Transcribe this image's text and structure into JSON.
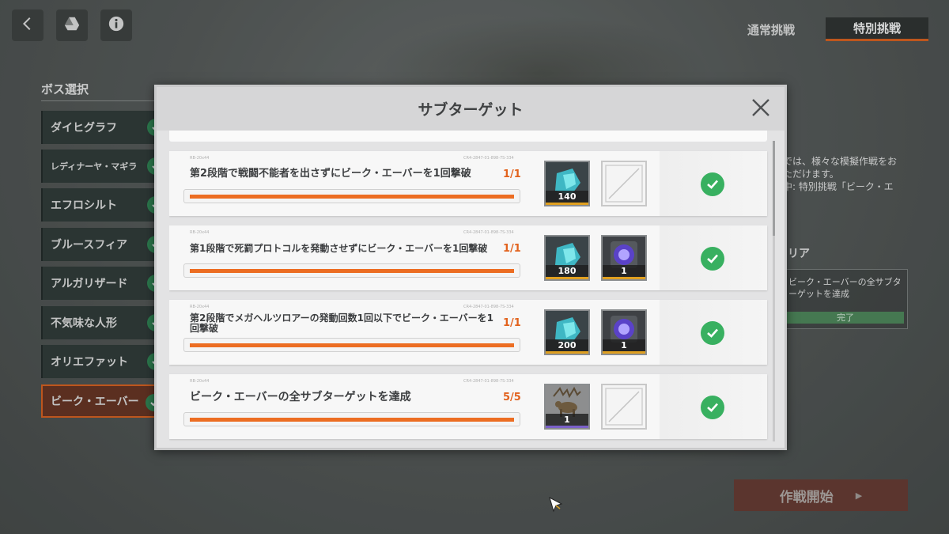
{
  "header": {
    "back_icon": "chevron-left-icon",
    "drive_icon": "triangle-logo-icon",
    "info_icon": "info-icon",
    "tabs": [
      {
        "label": "通常挑戦",
        "active": false
      },
      {
        "label": "特別挑戦",
        "active": true
      }
    ]
  },
  "boss_select": {
    "title": "ボス選択",
    "items": [
      {
        "label": "ダイヒグラフ",
        "cleared": true
      },
      {
        "label": "レディナーヤ・マギラ",
        "cleared": true
      },
      {
        "label": "エフロシルト",
        "cleared": true
      },
      {
        "label": "ブルースフィア",
        "cleared": true
      },
      {
        "label": "アルガリザード",
        "cleared": true
      },
      {
        "label": "不気味な人形",
        "cleared": true
      },
      {
        "label": "オリエファット",
        "cleared": true
      },
      {
        "label": "ビーク・エーバー",
        "cleared": true,
        "selected": true
      }
    ]
  },
  "right_panel": {
    "desc_line1": "では、様々な模擬作戦をお",
    "desc_line2": "ただけます。",
    "desc_line3": "中: 特別挑戦「ビーク・エ",
    "section_title": "リア",
    "box_text_1": "ビーク・エーバーの全サブタ",
    "box_text_2": "ーゲットを達成",
    "box_status": "完了"
  },
  "start_button": {
    "label": "作戦開始",
    "arrow": "▶"
  },
  "modal": {
    "title": "サブターゲット",
    "close_icon": "close-icon",
    "tasks": [
      {
        "code": "RB-20x44",
        "code2": "CR4-2847-01-898-7S-334",
        "label": "第2段階で戦闘不能者を出さずにビーク・エーバーを1回撃破",
        "progress": "1/1",
        "progress_fraction": 1.0,
        "rewards": [
          {
            "icon": "cyan-crystal-icon",
            "qty": "140",
            "rarity_color": "#e0a020"
          },
          {
            "icon": "empty-slot-icon",
            "qty": null
          }
        ],
        "claimed": true
      },
      {
        "code": "RB-20x44",
        "code2": "CR4-2847-01-898-7S-334",
        "label": "第1段階で死罰プロトコルを発動させずにビーク・エーバーを1回撃破",
        "progress": "1/1",
        "progress_fraction": 1.0,
        "rewards": [
          {
            "icon": "cyan-crystal-icon",
            "qty": "180",
            "rarity_color": "#e0a020"
          },
          {
            "icon": "purple-orb-icon",
            "qty": "1",
            "rarity_color": "#e0a020"
          }
        ],
        "claimed": true
      },
      {
        "code": "RB-20x44",
        "code2": "CR4-2847-01-898-7S-334",
        "label_line1": "第2段階でメガヘルツロアーの発動回数1回以下でビーク・エーバーを1",
        "label_line2": "回撃破",
        "progress": "1/1",
        "progress_fraction": 1.0,
        "rewards": [
          {
            "icon": "cyan-crystal-icon",
            "qty": "200",
            "rarity_color": "#e0a020"
          },
          {
            "icon": "purple-orb-icon",
            "qty": "1",
            "rarity_color": "#e0a020"
          }
        ],
        "claimed": true
      },
      {
        "code": "RB-20x44",
        "code2": "CR4-2847-01-898-7S-334",
        "label": "ビーク・エーバーの全サブターゲットを達成",
        "progress": "5/5",
        "progress_fraction": 1.0,
        "rewards": [
          {
            "icon": "moose-figure-icon",
            "qty": "1",
            "rarity_color": "#7b61c9"
          },
          {
            "icon": "empty-slot-icon",
            "qty": null
          }
        ],
        "claimed": true
      }
    ]
  },
  "colors": {
    "accent_orange": "#ec6d22",
    "check_green": "#38b060",
    "modal_bg": "#e3e3e4",
    "start_button_bg": "#6a3a31"
  }
}
